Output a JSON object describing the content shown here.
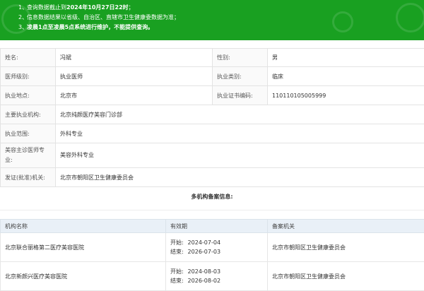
{
  "notice": [
    {
      "num": "1、",
      "text": "查询数据截止到",
      "strong": "2024年10月27日22时",
      "tail": "；"
    },
    {
      "num": "2、",
      "text": "信息数据结果以省级、自治区、直辖市卫生健康委数据为准；",
      "strong": "",
      "tail": ""
    },
    {
      "num": "3、",
      "text": "",
      "strong": "凌晨1点至凌晨5点系统进行维护，不能提供查询。",
      "tail": ""
    }
  ],
  "doctor": {
    "name_label": "姓名:",
    "name": "冯斌",
    "gender_label": "性别:",
    "gender": "男",
    "level_label": "医师级别:",
    "level": "执业医师",
    "category_label": "执业类别:",
    "category": "临床",
    "place_label": "执业地点:",
    "place": "北京市",
    "cert_label": "执业证书编码:",
    "cert": "110110105005999",
    "org_label": "主要执业机构:",
    "org": "北京纯颜医疗美容门诊部",
    "scope_label": "执业范围:",
    "scope": "外科专业",
    "cosmetic_label": "美容主诊医师专业:",
    "cosmetic": "美容外科专业",
    "issuer_label": "发证(批准)机关:",
    "issuer": "北京市朝阳区卫生健康委员会"
  },
  "multi_title": "多机构备案信息:",
  "institutions": {
    "headers": [
      "机构名称",
      "有效期",
      "备案机关"
    ],
    "start_label": "开始:",
    "end_label": "结束:",
    "rows": [
      {
        "name": "北京联合丽格第二医疗美容医院",
        "start": "2024-07-04",
        "end": "2026-07-03",
        "authority": "北京市朝阳区卫生健康委员会"
      },
      {
        "name": "北京新颜兴医疗美容医院",
        "start": "2024-08-03",
        "end": "2026-08-02",
        "authority": "北京市朝阳区卫生健康委员会"
      }
    ]
  },
  "colors": {
    "banner": "#19a021",
    "table_header": "#e9f0f7"
  }
}
